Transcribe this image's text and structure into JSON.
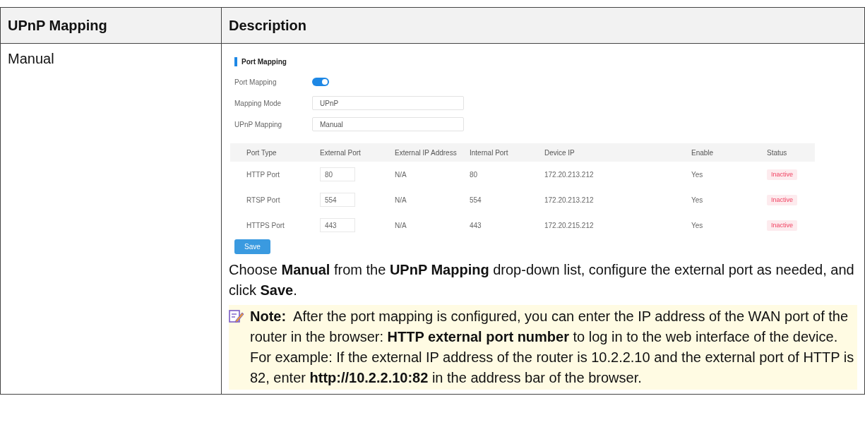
{
  "table": {
    "columns": [
      "UPnP Mapping",
      "Description"
    ],
    "rows": [
      {
        "mapping": "Manual",
        "screenshot": {
          "title": "Port Mapping",
          "fields": [
            {
              "kind": "toggle",
              "label": "Port Mapping",
              "on": true
            },
            {
              "kind": "select",
              "label": "Mapping Mode",
              "value": "UPnP"
            },
            {
              "kind": "select",
              "label": "UPnP Mapping",
              "value": "Manual"
            }
          ],
          "port_table": {
            "columns": [
              "Port Type",
              "External Port",
              "External IP Address",
              "Internal Port",
              "Device IP",
              "Enable",
              "Status"
            ],
            "rows": [
              {
                "port_type": "HTTP Port",
                "external_port": "80",
                "external_ip": "N/A",
                "internal_port": "80",
                "device_ip": "172.20.213.212",
                "enable": "Yes",
                "status": "Inactive"
              },
              {
                "port_type": "RTSP Port",
                "external_port": "554",
                "external_ip": "N/A",
                "internal_port": "554",
                "device_ip": "172.20.213.212",
                "enable": "Yes",
                "status": "Inactive"
              },
              {
                "port_type": "HTTPS Port",
                "external_port": "443",
                "external_ip": "N/A",
                "internal_port": "443",
                "device_ip": "172.20.215.212",
                "enable": "Yes",
                "status": "Inactive"
              }
            ]
          },
          "button": "Save"
        },
        "instruction": "Choose **Manual** from the **UPnP Mapping** drop-down list, configure the external port as needed, and click **Save**.",
        "note": {
          "label": "Note:",
          "text": "After the port mapping is configured, you can enter the IP address of the WAN port of the router in the browser: **HTTP external port number** to log in to the web interface of the device. For example: If the external IP address of the router is 10.2.2.10 and the external port of HTTP is 82, enter **http://10.2.2.10:82** in the address bar of the browser."
        }
      }
    ]
  }
}
